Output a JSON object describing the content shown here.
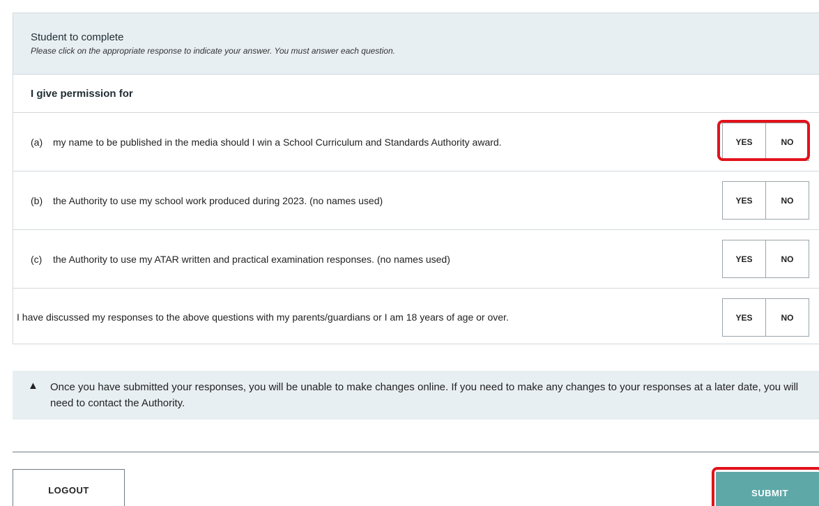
{
  "header": {
    "title": "Student to complete",
    "subtitle": "Please click on the appropriate response to indicate your answer. You must answer each question."
  },
  "intro": "I give permission for",
  "questions": [
    {
      "letter": "(a)",
      "text": "my name to be published in the media should I win a School Curriculum and Standards Authority award.",
      "yes": "YES",
      "no": "NO"
    },
    {
      "letter": "(b)",
      "text": "the Authority to use my school work produced during 2023. (no names used)",
      "yes": "YES",
      "no": "NO"
    },
    {
      "letter": "(c)",
      "text": "the Authority to use my ATAR written and practical examination responses. (no names used)",
      "yes": "YES",
      "no": "NO"
    },
    {
      "letter": "",
      "text": "I have discussed my responses to the above questions with my parents/guardians or I am 18 years of age or over.",
      "yes": "YES",
      "no": "NO"
    }
  ],
  "notice": {
    "icon": "warning-icon",
    "text": "Once you have submitted your responses, you will be unable to make changes online. If you need to make any changes to your responses at a later date, you will need to contact the Authority."
  },
  "actions": {
    "logout": "LOGOUT",
    "submit": "SUBMIT"
  },
  "colors": {
    "header_bg": "#e8eff2",
    "submit_bg": "#5fa8a8",
    "highlight": "#e2121b"
  }
}
